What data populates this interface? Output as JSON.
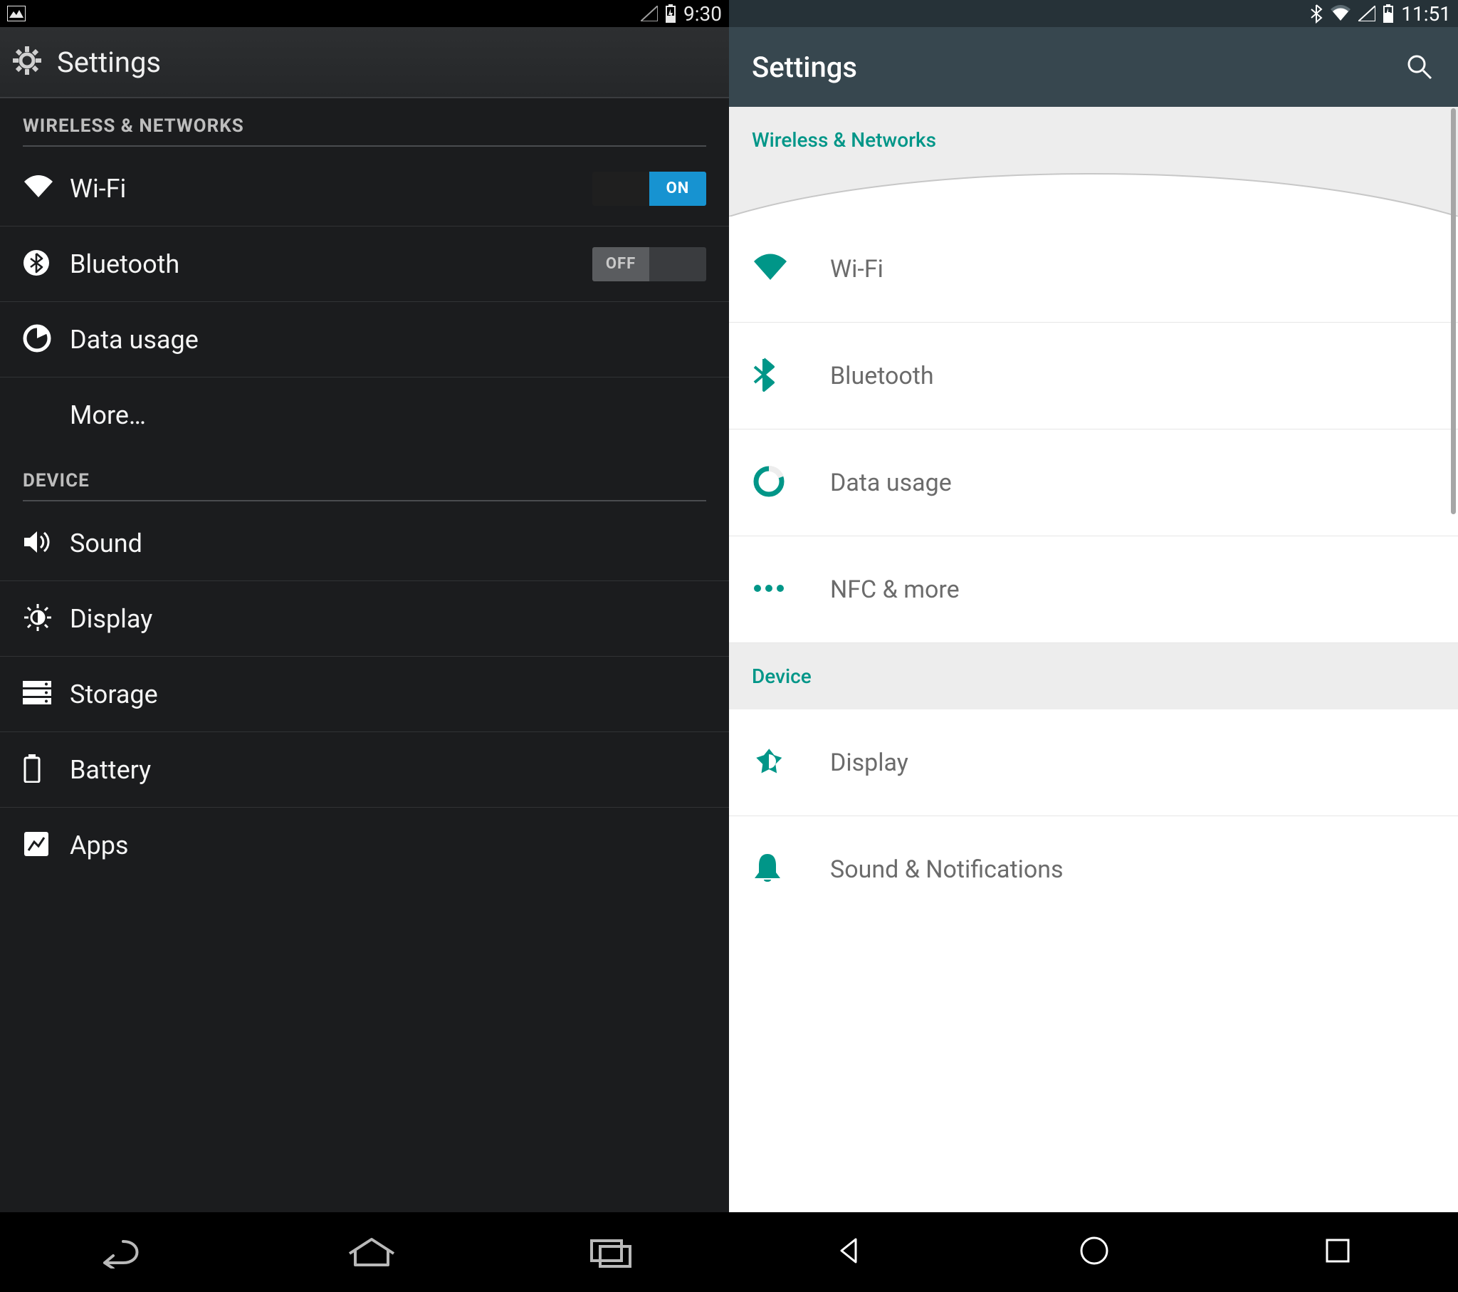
{
  "left": {
    "statusbar": {
      "time": "9:30"
    },
    "appbar": {
      "title": "Settings"
    },
    "sections": [
      {
        "header": "WIRELESS & NETWORKS",
        "items": [
          {
            "icon": "wifi",
            "label": "Wi-Fi",
            "toggle": "ON"
          },
          {
            "icon": "bluetooth",
            "label": "Bluetooth",
            "toggle": "OFF"
          },
          {
            "icon": "data-usage",
            "label": "Data usage"
          },
          {
            "icon": "",
            "label": "More…"
          }
        ]
      },
      {
        "header": "DEVICE",
        "items": [
          {
            "icon": "sound",
            "label": "Sound"
          },
          {
            "icon": "display",
            "label": "Display"
          },
          {
            "icon": "storage",
            "label": "Storage"
          },
          {
            "icon": "battery",
            "label": "Battery"
          },
          {
            "icon": "apps",
            "label": "Apps"
          }
        ]
      }
    ],
    "toggle_labels": {
      "on": "ON",
      "off": "OFF"
    }
  },
  "right": {
    "statusbar": {
      "time": "11:51"
    },
    "appbar": {
      "title": "Settings"
    },
    "sections": [
      {
        "header": "Wireless & Networks",
        "items": [
          {
            "icon": "wifi",
            "label": "Wi-Fi"
          },
          {
            "icon": "bluetooth",
            "label": "Bluetooth"
          },
          {
            "icon": "data-usage",
            "label": "Data usage"
          },
          {
            "icon": "more",
            "label": "NFC & more"
          }
        ]
      },
      {
        "header": "Device",
        "items": [
          {
            "icon": "display",
            "label": "Display"
          },
          {
            "icon": "bell",
            "label": "Sound & Notifications"
          }
        ]
      }
    ]
  }
}
